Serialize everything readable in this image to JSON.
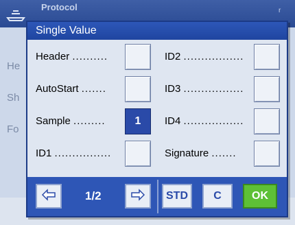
{
  "background": {
    "title": "Protocol",
    "side_labels": [
      "He",
      "Sh",
      "Fo"
    ],
    "right_text": "r"
  },
  "dialog": {
    "title": "Single Value",
    "left_items": [
      {
        "label": "Header",
        "dots": "..........",
        "value": ""
      },
      {
        "label": "AutoStart",
        "dots": ".......",
        "value": ""
      },
      {
        "label": "Sample",
        "dots": ".........",
        "value": "1"
      },
      {
        "label": "ID1",
        "dots": "................",
        "value": ""
      }
    ],
    "right_items": [
      {
        "label": "ID2",
        "dots": ".................",
        "value": ""
      },
      {
        "label": "ID3",
        "dots": ".................",
        "value": ""
      },
      {
        "label": "ID4",
        "dots": ".................",
        "value": ""
      },
      {
        "label": "Signature",
        "dots": ".......",
        "value": ""
      }
    ]
  },
  "toolbar": {
    "page_indicator": "1/2",
    "std_label": "STD",
    "c_label": "C",
    "ok_label": "OK"
  },
  "colors": {
    "accent": "#2e56b6",
    "ok": "#5ec036"
  }
}
